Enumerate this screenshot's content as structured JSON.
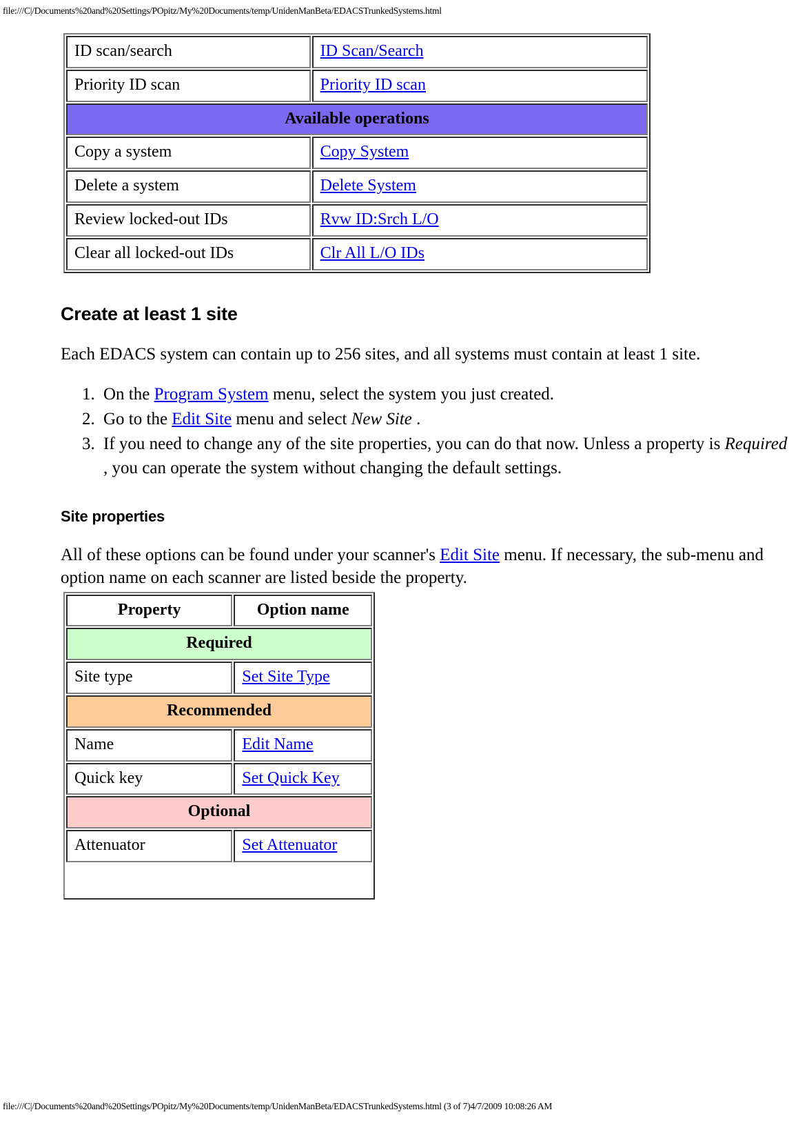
{
  "page": {
    "header_path": "file:///C|/Documents%20and%20Settings/POpitz/My%20Documents/temp/UnidenManBeta/EDACSTrunkedSystems.html",
    "footer_path": "file:///C|/Documents%20and%20Settings/POpitz/My%20Documents/temp/UnidenManBeta/EDACSTrunkedSystems.html (3 of 7)4/7/2009 10:08:26 AM"
  },
  "colors": {
    "link": "#0000EE",
    "purple_header": "#7B68EE",
    "required_green": "#CCFFCC",
    "recommended_peach": "#FFCC99",
    "optional_pink": "#FFCCCC",
    "table_border": "#808080"
  },
  "operations_table": {
    "rows": [
      {
        "type": "item",
        "property": "ID scan/search",
        "option": "ID Scan/Search"
      },
      {
        "type": "item",
        "property": "Priority ID scan",
        "option": "Priority ID scan"
      },
      {
        "type": "section",
        "label": "Available operations"
      },
      {
        "type": "item",
        "property": "Copy a system",
        "option": "Copy System"
      },
      {
        "type": "item",
        "property": "Delete a system",
        "option": "Delete System"
      },
      {
        "type": "item",
        "property": "Review locked-out IDs",
        "option": "Rvw ID:Srch L/O"
      },
      {
        "type": "item",
        "property": "Clear all locked-out IDs",
        "option": "Clr All L/O IDs"
      }
    ]
  },
  "create_site": {
    "heading": "Create at least 1 site",
    "intro": "Each EDACS system can contain up to 256 sites, and all systems must contain at least 1 site.",
    "steps": [
      {
        "prefix": "On the ",
        "link": "Program System",
        "suffix": " menu, select the system you just created.",
        "italic": "",
        "tail": ""
      },
      {
        "prefix": "Go to the ",
        "link": "Edit Site",
        "suffix": " menu and select ",
        "italic": "New Site",
        "tail": " ."
      },
      {
        "prefix": "If you need to change any of the site properties, you can do that now. Unless a property is ",
        "link": "",
        "suffix": "",
        "italic": "Required",
        "tail": " , you can operate the system without changing the default settings."
      }
    ]
  },
  "site_properties": {
    "heading": "Site properties",
    "intro_prefix": "All of these options can be found under your scanner's ",
    "intro_link": "Edit Site",
    "intro_suffix": " menu. If necessary, the sub-menu and option name on each scanner are listed beside the property.",
    "columns": [
      "Property",
      "Option name"
    ],
    "rows": [
      {
        "type": "section",
        "label": "Required"
      },
      {
        "type": "item",
        "property": "Site type",
        "option": "Set Site Type"
      },
      {
        "type": "section",
        "label": "Recommended"
      },
      {
        "type": "item",
        "property": "Name",
        "option": "Edit Name"
      },
      {
        "type": "item",
        "property": "Quick key",
        "option": "Set Quick Key"
      },
      {
        "type": "section",
        "label": "Optional"
      },
      {
        "type": "item",
        "property": "Attenuator",
        "option": "Set Attenuator"
      }
    ]
  }
}
